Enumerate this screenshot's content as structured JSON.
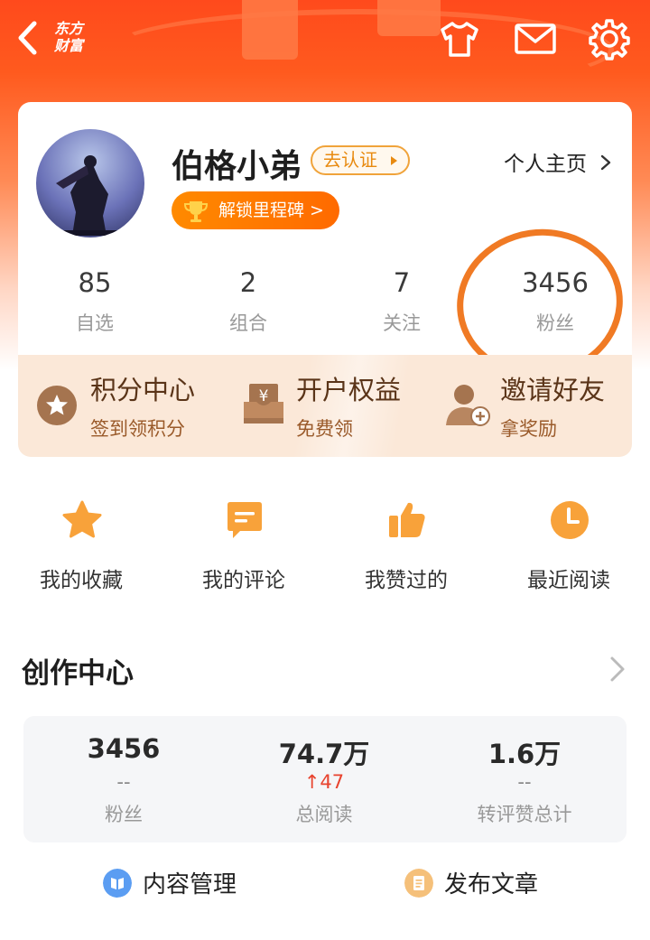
{
  "header": {
    "back_icon": "chevron-left-icon",
    "logo_line1": "东方",
    "logo_line2": "财富",
    "icons": [
      "tshirt-icon",
      "mail-icon",
      "gear-icon"
    ],
    "primary_color": "#ff5a1e"
  },
  "profile": {
    "username": "伯格小弟",
    "verify_label": "去认证",
    "homepage_label": "个人主页",
    "milestone_label": "解锁里程碑 >",
    "stats": [
      {
        "value": "85",
        "label": "自选"
      },
      {
        "value": "2",
        "label": "组合"
      },
      {
        "value": "7",
        "label": "关注"
      },
      {
        "value": "3456",
        "label": "粉丝"
      }
    ],
    "highlight_color": "#f07a24"
  },
  "promo": [
    {
      "title": "积分中心",
      "subtitle": "签到领积分",
      "icon": "star-badge-icon"
    },
    {
      "title": "开户权益",
      "subtitle": "免费领",
      "icon": "yen-box-icon"
    },
    {
      "title": "邀请好友",
      "subtitle": "拿奖励",
      "icon": "add-user-icon"
    }
  ],
  "quick_actions": [
    {
      "label": "我的收藏",
      "icon": "star-icon"
    },
    {
      "label": "我的评论",
      "icon": "comment-icon"
    },
    {
      "label": "我赞过的",
      "icon": "thumbs-up-icon"
    },
    {
      "label": "最近阅读",
      "icon": "clock-icon"
    }
  ],
  "creation": {
    "title": "创作中心",
    "stats": [
      {
        "value": "3456",
        "delta": "--",
        "label": "粉丝"
      },
      {
        "value": "74.7万",
        "delta": "↑47",
        "label": "总阅读"
      },
      {
        "value": "1.6万",
        "delta": "--",
        "label": "转评赞总计"
      }
    ],
    "actions": [
      {
        "label": "内容管理",
        "icon": "content-manage-icon"
      },
      {
        "label": "发布文章",
        "icon": "publish-article-icon"
      }
    ]
  }
}
